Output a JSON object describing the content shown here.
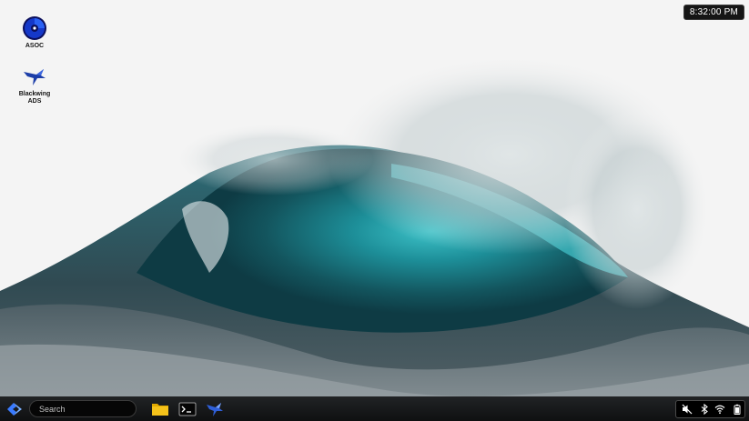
{
  "clock": {
    "time": "8:32:00 PM"
  },
  "desktop": {
    "icons": [
      {
        "label": "ASOC",
        "icon": "disc-icon"
      },
      {
        "label": "Blackwing\nADS",
        "icon": "blackwing-bird-icon"
      }
    ]
  },
  "taskbar": {
    "start_icon": "start-logo-icon",
    "search": {
      "placeholder": "Search",
      "value": ""
    },
    "apps": [
      {
        "icon": "folder-icon"
      },
      {
        "icon": "terminal-icon"
      },
      {
        "icon": "blackwing-bird-icon"
      }
    ],
    "tray": {
      "icons": [
        "volume-muted-icon",
        "bluetooth-icon",
        "wifi-icon",
        "battery-icon"
      ]
    }
  },
  "colors": {
    "taskbar": "#121314",
    "clock_bg": "#151515",
    "folder": "#f5c21a",
    "wave_teal": "#1b8a93"
  }
}
